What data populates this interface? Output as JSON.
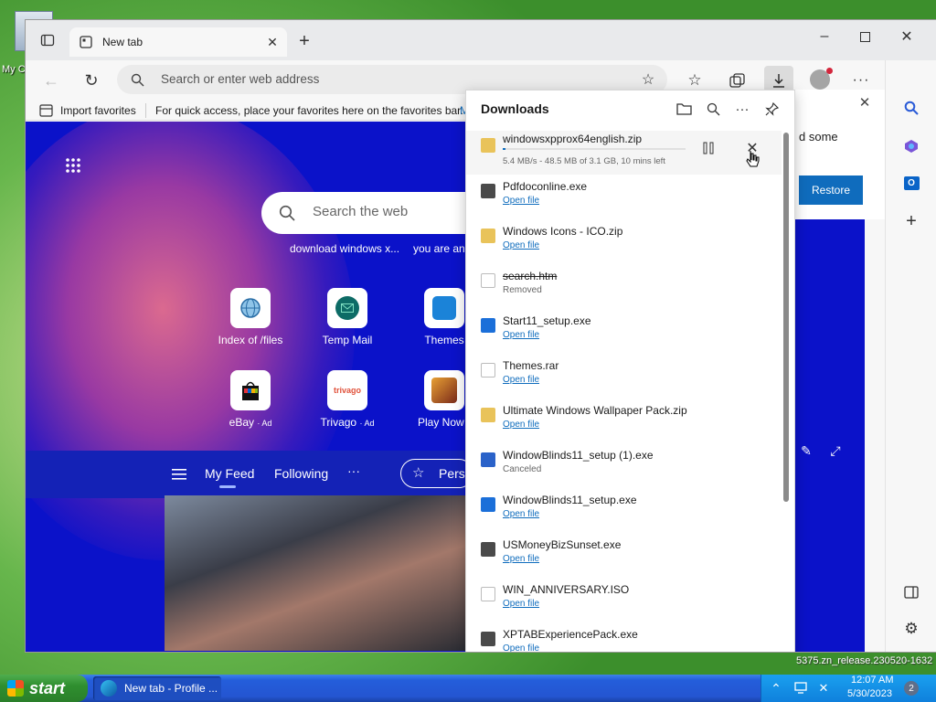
{
  "desktop": {
    "icon_label": "My C"
  },
  "browser": {
    "tab_title": "New tab",
    "address_placeholder": "Search or enter web address",
    "favbar_import": "Import favorites",
    "favbar_hint": "For quick access, place your favorites here on the favorites bar.",
    "favbar_link_fragment": "M"
  },
  "newtab": {
    "search_placeholder": "Search the web",
    "suggestions": [
      "download windows x...",
      "you are an"
    ],
    "tiles": [
      {
        "label": "Index of /files",
        "icon": "globe-icon"
      },
      {
        "label": "Temp Mail",
        "icon": "mail-icon"
      },
      {
        "label": "Themes",
        "icon": "themes-icon"
      },
      {
        "label": "eBay",
        "ad": "· Ad",
        "icon": "ebay-bag-icon"
      },
      {
        "label": "Trivago",
        "ad": "· Ad",
        "icon_text": "trivago"
      },
      {
        "label": "Play Now ·",
        "icon": "game-icon"
      }
    ],
    "feed_tabs": [
      "My Feed",
      "Following",
      "···"
    ],
    "personalize_fragment": "Pers"
  },
  "downloads": {
    "title": "Downloads",
    "active": {
      "name": "windowsxpprox64english.zip",
      "status": "5.4 MB/s - 48.5 MB of 3.1 GB, 10 mins left",
      "progress": 0.015
    },
    "items": [
      {
        "name": "Pdfdoconline.exe",
        "status": "Open file",
        "kind": "exe",
        "link": true
      },
      {
        "name": "Windows Icons - ICO.zip",
        "status": "Open file",
        "kind": "zip",
        "link": true
      },
      {
        "name": "search.htm",
        "status": "Removed",
        "kind": "doc",
        "link": false,
        "strike": true
      },
      {
        "name": "Start11_setup.exe",
        "status": "Open file",
        "kind": "setup",
        "link": true
      },
      {
        "name": "Themes.rar",
        "status": "Open file",
        "kind": "doc",
        "link": true
      },
      {
        "name": "Ultimate Windows Wallpaper Pack.zip",
        "status": "Open file",
        "kind": "zip",
        "link": true
      },
      {
        "name": "WindowBlinds11_setup (1).exe",
        "status": "Canceled",
        "kind": "exe-blue",
        "link": false
      },
      {
        "name": "WindowBlinds11_setup.exe",
        "status": "Open file",
        "kind": "setup",
        "link": true
      },
      {
        "name": "USMoneyBizSunset.exe",
        "status": "Open file",
        "kind": "exe",
        "link": true
      },
      {
        "name": "WIN_ANNIVERSARY.ISO",
        "status": "Open file",
        "kind": "doc",
        "link": true
      },
      {
        "name": "XPTABExperiencePack.exe",
        "status": "Open file",
        "kind": "exe",
        "link": true
      }
    ]
  },
  "notification": {
    "text_fragment": "d some",
    "button": "Restore"
  },
  "watermark": "5375.zn_release.230520-1632",
  "taskbar": {
    "start": "start",
    "window_button": "New tab - Profile ...",
    "time": "12:07 AM",
    "date": "5/30/2023",
    "badge": "2"
  }
}
